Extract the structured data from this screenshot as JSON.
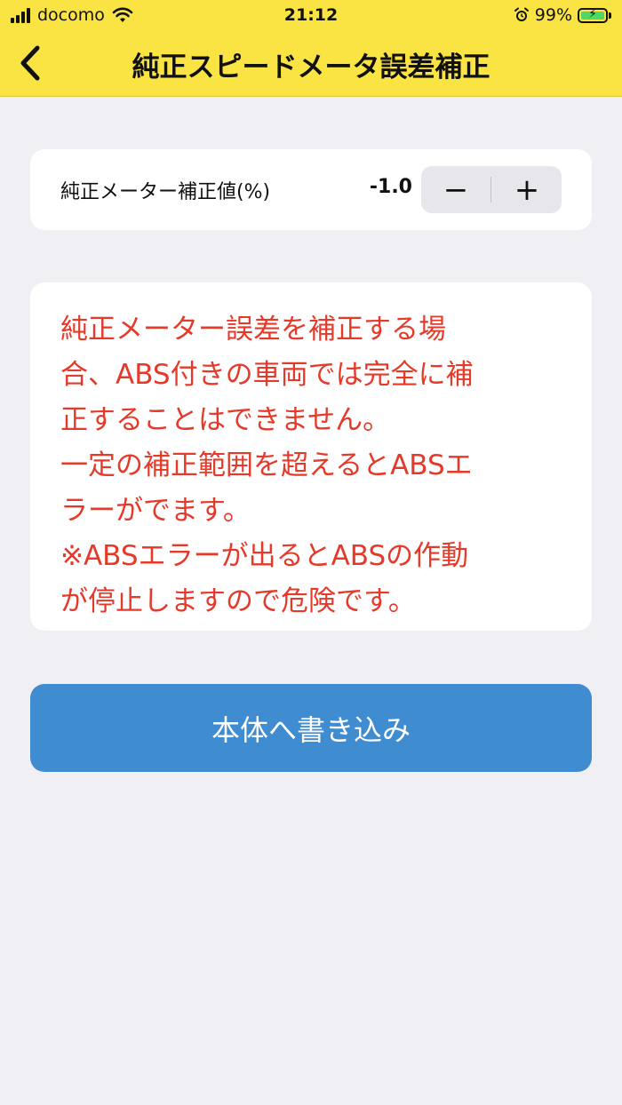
{
  "status_bar": {
    "carrier": "docomo",
    "time": "21:12",
    "battery_percent": "99%",
    "icons": [
      "signal-icon",
      "wifi-icon",
      "alarm-icon",
      "battery-charging-icon"
    ]
  },
  "nav": {
    "title": "純正スピードメータ誤差補正",
    "back_icon": "chevron-left-icon"
  },
  "setting": {
    "label": "純正メーター補正値(%)",
    "value": "-1.0",
    "minus_symbol": "−",
    "plus_symbol": "+"
  },
  "warning": {
    "lines": [
      "純正メーター誤差を補正する場",
      "合、ABS付きの車両では完全に補",
      "正することはできません。",
      "一定の補正範囲を超えるとABSエ",
      "ラーがでます。",
      "※ABSエラーが出るとABSの作動",
      "が停止しますので危険です。"
    ],
    "color": "#e53a2a"
  },
  "write_button": {
    "label": "本体へ書き込み"
  },
  "colors": {
    "header_bg": "#fae443",
    "page_bg": "#efeff4",
    "button_bg": "#3f8cd1"
  }
}
